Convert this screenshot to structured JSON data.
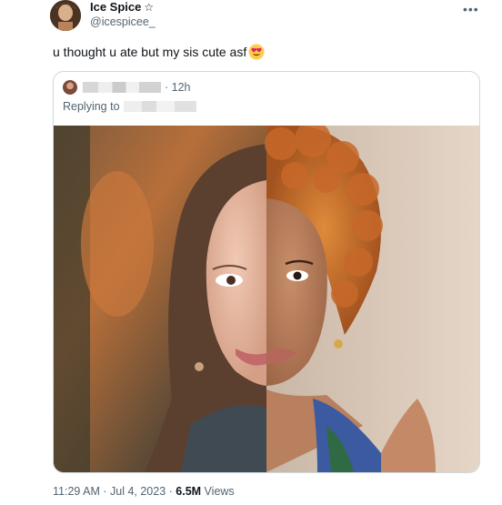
{
  "tweet": {
    "author": {
      "display_name": "Ice Spice",
      "badge_icon": "star-outline-icon",
      "handle": "@icespicee_"
    },
    "more_icon": "more-icon",
    "text": "u thought u ate but my sis cute asf",
    "emoji": "heart-eyes-emoji",
    "quote": {
      "time": "· 12h",
      "replying_label": "Replying to",
      "image": "side-by-side-face-photo"
    },
    "meta": {
      "time": "11:29 AM",
      "separator": " · ",
      "date": "Jul 4, 2023",
      "separator2": " · ",
      "views_count": "6.5M",
      "views_label": " Views"
    }
  },
  "colors": {
    "text": "#0f1419",
    "secondary": "#536471",
    "border": "#cfd9de"
  }
}
